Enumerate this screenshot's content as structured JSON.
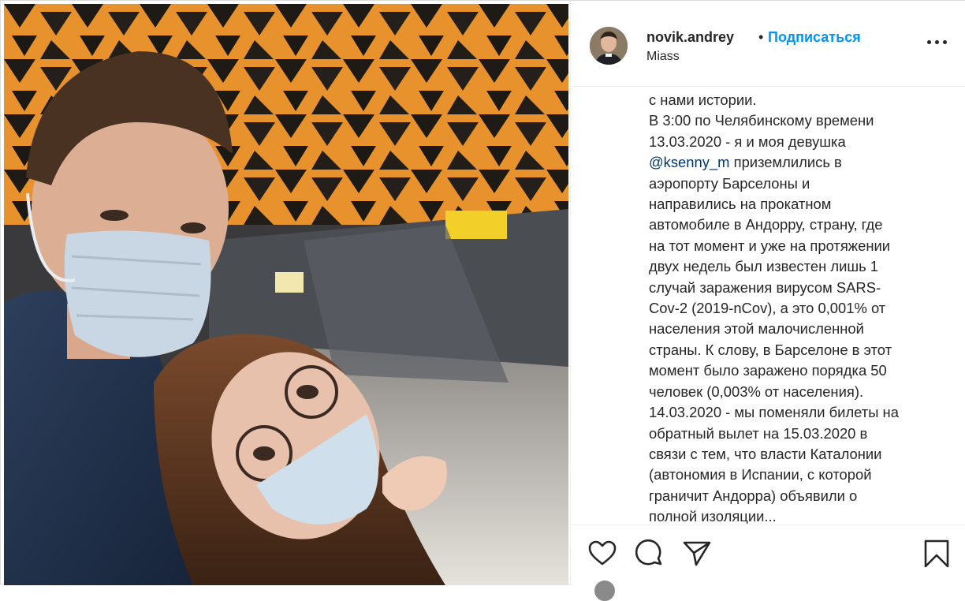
{
  "post": {
    "username": "novik.andrey",
    "separator": "•",
    "follow_label": "Подписаться",
    "location": "Miass",
    "photo_description_icon": "selfie-photo",
    "caption_lines": [
      "с нами истории.",
      "В 3:00 по Челябинскому времени",
      "13.03.2020 - я и моя девушка",
      "@ksenny_m",
      " приземлились в",
      "аэропорту Барселоны и",
      "направились на прокатном",
      "автомобиле в Андорру, страну, где",
      "на тот момент и уже на протяжении",
      "двух недель был известен лишь 1",
      "случай заражения вирусом SARS-",
      "Cov-2 (2019-nCov), а это 0,001% от",
      "населения этой малочисленной",
      "страны. К слову, в Барселоне в этот",
      "момент было заражено порядка 50",
      "человек (0,003% от населения).",
      "14.03.2020 - мы поменяли билеты на",
      "обратный вылет на 15.03.2020 в",
      "связи с тем, что власти Каталонии",
      "(автономия в Испании, с которой",
      "граничит Андорра) объявили о",
      "полной изоляции..."
    ]
  },
  "actions": {
    "like_icon": "heart-icon",
    "comment_icon": "comment-icon",
    "share_icon": "paper-plane-icon",
    "save_icon": "bookmark-icon",
    "more_icon": "more-options-icon"
  },
  "colors": {
    "link": "#0095f6",
    "mention": "#00376b",
    "text": "#262626",
    "border": "#dbdbdb"
  }
}
